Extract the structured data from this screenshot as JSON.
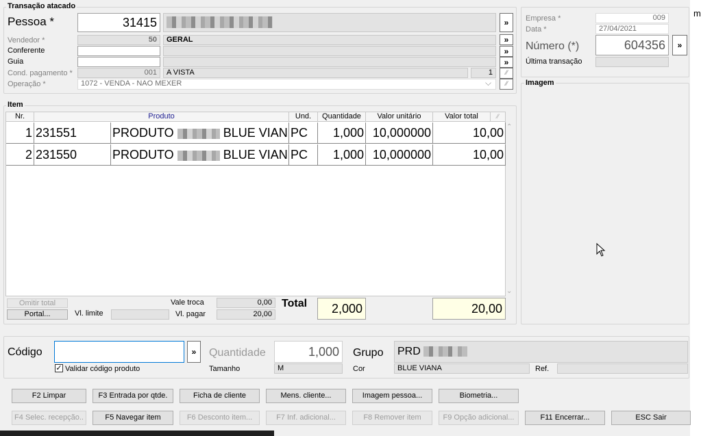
{
  "transacao": {
    "legend": "Transação atacado",
    "pessoa_label": "Pessoa *",
    "pessoa_code": "31415",
    "vendedor_label": "Vendedor *",
    "vendedor_code": "50",
    "vendedor_name": "GERAL",
    "conferente_label": "Conferente",
    "guia_label": "Guia",
    "cond_label": "Cond. pagamento *",
    "cond_code": "001",
    "cond_name": "A VISTA",
    "cond_parcelas": "1",
    "operacao_label": "Operação *",
    "operacao_value": "1072 - VENDA - NAO MEXER",
    "more": "»"
  },
  "empresa": {
    "empresa_label": "Empresa *",
    "empresa_value": "009",
    "data_label": "Data *",
    "data_value": "27/04/2021",
    "numero_label": "Número (*)",
    "numero_value": "604356",
    "ultima_label": "Última transação",
    "imagem_legend": "Imagem"
  },
  "item": {
    "legend": "Item",
    "headers": [
      "Nr.",
      "Produto",
      "Und.",
      "Quantidade",
      "Valor unitário",
      "Valor total"
    ],
    "rows": [
      {
        "nr": "1",
        "code": "231551",
        "desc1": "PRODUTO",
        "desc2": "BLUE VIAN",
        "und": "PC",
        "qtd": "1,000",
        "unit": "10,000000",
        "total": "10,00"
      },
      {
        "nr": "2",
        "code": "231550",
        "desc1": "PRODUTO",
        "desc2": "BLUE VIAN",
        "und": "PC",
        "qtd": "1,000",
        "unit": "10,000000",
        "total": "10,00"
      }
    ],
    "omitir_total": "Omitir total",
    "portal": "Portal...",
    "vl_limite_label": "Vl. limite",
    "vale_troca_label": "Vale troca",
    "vale_troca_value": "0,00",
    "vl_pagar_label": "Vl. pagar",
    "vl_pagar_value": "20,00",
    "total_label": "Total",
    "total_qtd": "2,000",
    "total_valor": "20,00"
  },
  "entry": {
    "codigo_label": "Código",
    "codigo_value": "",
    "validar_label": "Validar código produto",
    "quantidade_label": "Quantidade",
    "quantidade_value": "1,000",
    "tamanho_label": "Tamanho",
    "tamanho_value": "M",
    "grupo_label": "Grupo",
    "grupo_value": "PRD",
    "cor_label": "Cor",
    "cor_value": "BLUE VIANA",
    "ref_label": "Ref."
  },
  "buttons": {
    "f2": "F2 Limpar",
    "f3": "F3 Entrada por qtde.",
    "ficha": "Ficha de cliente",
    "mens": "Mens. cliente...",
    "imagem": "Imagem pessoa...",
    "biometria": "Biometria...",
    "f4": "F4 Selec. recepção..",
    "f5": "F5 Navegar item",
    "f6": "F6 Desconto item...",
    "f7": "F7 Inf. adicional...",
    "f8": "F8 Remover item",
    "f9": "F9 Opção adicional...",
    "f11": "F11 Encerrar...",
    "esc": "ESC Sair"
  },
  "edge_text": "mi"
}
